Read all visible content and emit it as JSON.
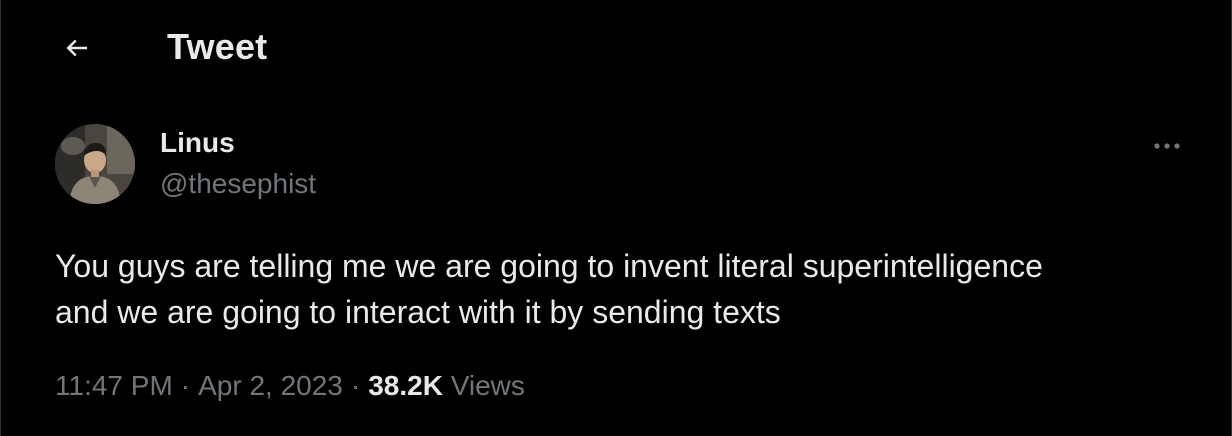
{
  "header": {
    "back_icon": "arrow-left-icon",
    "title": "Tweet"
  },
  "tweet": {
    "author": {
      "display_name": "Linus",
      "handle": "@thesephist",
      "avatar_icon": "profile-photo"
    },
    "more_icon": "ellipsis-icon",
    "text": "You guys are telling me we are going to invent literal superintelligence\nand we are going to interact with it by sending texts",
    "time": "11:47 PM",
    "separator": "·",
    "date": "Apr 2, 2023",
    "views_count": "38.2K",
    "views_label": "Views"
  },
  "colors": {
    "background": "#000000",
    "primary_text": "#e7e9ea",
    "secondary_text": "#71767b",
    "border": "#2f3336"
  }
}
